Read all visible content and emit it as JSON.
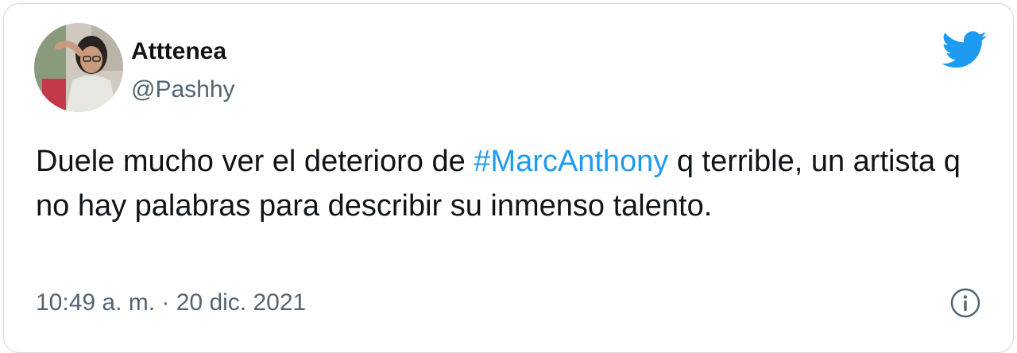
{
  "tweet": {
    "author": {
      "display_name": "Atttenea",
      "handle": "@Pashhy"
    },
    "text": {
      "before": "Duele mucho ver el deterioro de ",
      "hashtag": "#MarcAnthony",
      "after": " q terrible, un artista q no hay palabras para describir su inmenso talento."
    },
    "timestamp": "10:49 a. m. · 20 dic. 2021"
  },
  "colors": {
    "brand": "#1d9bf0",
    "text_primary": "#0f1419",
    "text_secondary": "#536471"
  },
  "icons": {
    "logo": "twitter-bird-icon",
    "info": "info-icon"
  }
}
